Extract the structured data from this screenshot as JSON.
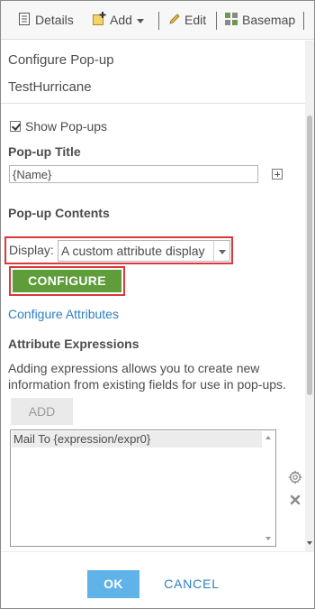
{
  "toolbar": {
    "details_label": "Details",
    "add_label": "Add",
    "edit_label": "Edit",
    "basemap_label": "Basemap"
  },
  "panel": {
    "title": "Configure Pop-up",
    "layer_name": "TestHurricane",
    "show_popups_label": "Show Pop-ups",
    "show_popups_checked": true,
    "popup_title_heading": "Pop-up Title",
    "popup_title_value": "{Name}",
    "popup_contents_heading": "Pop-up Contents",
    "display_label": "Display:",
    "display_value": "A custom attribute display",
    "configure_button": "CONFIGURE",
    "configure_attributes_link": "Configure Attributes",
    "attribute_expressions_heading": "Attribute Expressions",
    "attribute_expressions_help": "Adding expressions allows you to create new information from existing fields for use in pop-ups.",
    "add_button": "ADD",
    "expressions": [
      "Mail To {expression/expr0}"
    ]
  },
  "footer": {
    "ok_button": "OK",
    "cancel_button": "CANCEL"
  },
  "colors": {
    "configure_green": "#5e9d3a",
    "ok_blue": "#5fb3e8",
    "link_blue": "#2c7ec2",
    "highlight_red": "#d9393b"
  }
}
